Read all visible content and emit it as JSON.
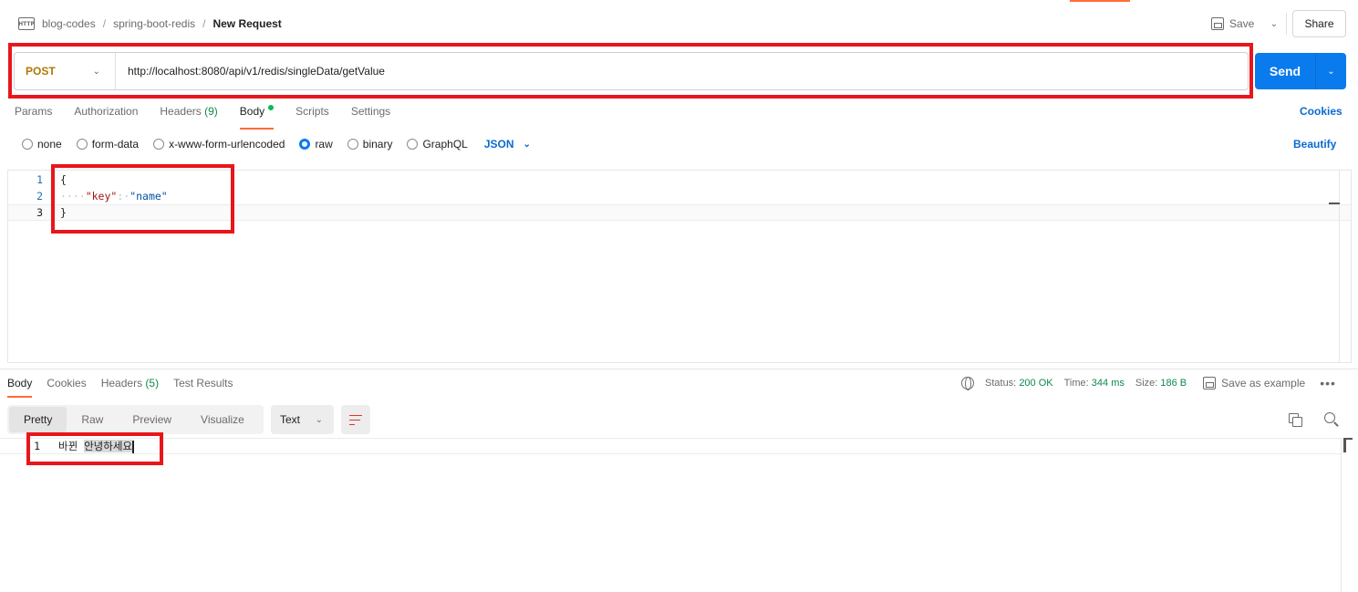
{
  "header": {
    "breadcrumb": [
      "blog-codes",
      "spring-boot-redis"
    ],
    "separator": "/",
    "current": "New Request",
    "request_icon_label": "HTTP",
    "save_label": "Save",
    "share_label": "Share"
  },
  "request": {
    "method": "POST",
    "url": "http://localhost:8080/api/v1/redis/singleData/getValue",
    "send_label": "Send"
  },
  "request_tabs": {
    "params": "Params",
    "authorization": "Authorization",
    "headers": "Headers",
    "headers_count": "(9)",
    "body": "Body",
    "scripts": "Scripts",
    "settings": "Settings",
    "cookies": "Cookies",
    "active": "Body"
  },
  "body_types": {
    "none": "none",
    "form_data": "form-data",
    "urlencoded": "x-www-form-urlencoded",
    "raw": "raw",
    "binary": "binary",
    "graphql": "GraphQL",
    "selected": "raw",
    "language": "JSON",
    "beautify": "Beautify"
  },
  "editor": {
    "line_numbers": [
      "1",
      "2",
      "3"
    ],
    "open_brace": "{",
    "indent": "····",
    "key": "\"key\"",
    "colon": ":·",
    "value": "\"name\"",
    "close_brace": "}"
  },
  "response_tabs": {
    "body": "Body",
    "cookies": "Cookies",
    "headers": "Headers",
    "headers_count": "(5)",
    "test_results": "Test Results",
    "active": "Body"
  },
  "response_meta": {
    "status_label": "Status:",
    "status_value": "200 OK",
    "time_label": "Time:",
    "time_value": "344 ms",
    "size_label": "Size:",
    "size_value": "186 B",
    "save_example": "Save as example",
    "more": "•••"
  },
  "response_view": {
    "pretty": "Pretty",
    "raw": "Raw",
    "preview": "Preview",
    "visualize": "Visualize",
    "active": "Pretty",
    "format": "Text"
  },
  "response_body": {
    "line_number": "1",
    "prefix": "바뀐 ",
    "selected_text": "안녕하세요"
  },
  "colors": {
    "accent": "#ff6c37",
    "primary_blue": "#097bed",
    "method_post": "#ad7a03",
    "status_green": "#0f8a4a",
    "annotation_red": "#e8161b"
  }
}
